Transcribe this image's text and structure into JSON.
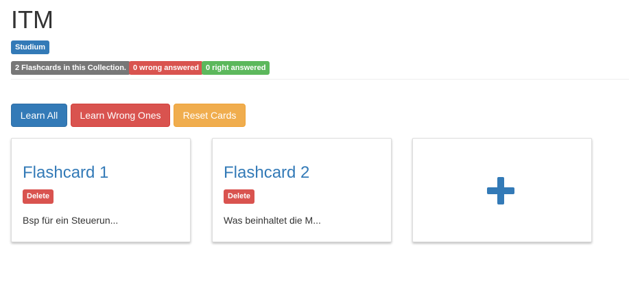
{
  "page": {
    "title": "ITM",
    "category_label": "Studium"
  },
  "stats": {
    "flashcards_count": "2 Flashcards in this Collection.",
    "wrong_answered": "0 wrong answered",
    "right_answered": "0 right answered"
  },
  "actions": {
    "learn_all": "Learn All",
    "learn_wrong": "Learn Wrong Ones",
    "reset": "Reset Cards"
  },
  "cards": [
    {
      "title": "Flashcard 1",
      "delete_label": "Delete",
      "preview": "Bsp für ein Steuerun..."
    },
    {
      "title": "Flashcard 2",
      "delete_label": "Delete",
      "preview": "Was beinhaltet die M..."
    }
  ],
  "add_card": {
    "icon": "plus-icon"
  },
  "colors": {
    "primary": "#337ab7",
    "danger": "#d9534f",
    "warning": "#f0ad4e",
    "success": "#5cb85c",
    "default": "#777777"
  }
}
